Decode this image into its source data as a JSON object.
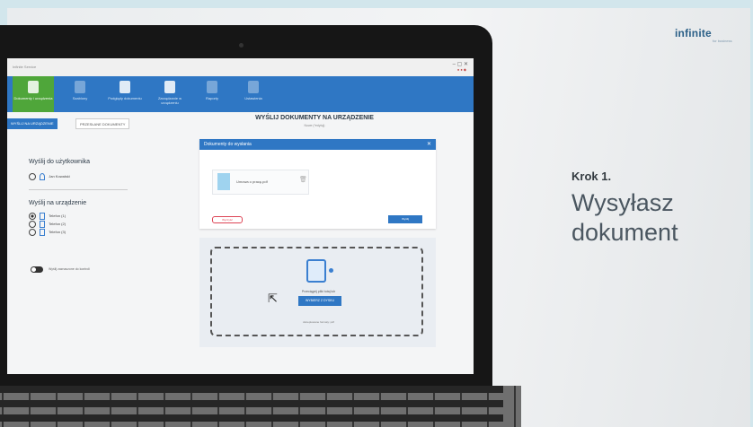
{
  "slide": {
    "brand": "infinite",
    "brand_sub": "for business",
    "step_label": "Krok 1.",
    "step_title": "Wysyłasz dokument"
  },
  "app": {
    "title_bar": "Infinite Service",
    "ribbon": [
      {
        "label": "Dokumenty i urządzenia",
        "icon": "phone-document-icon",
        "active": true
      },
      {
        "label": "Szablony",
        "icon": "template-icon",
        "active": false
      },
      {
        "label": "Podglądy dokumentu",
        "icon": "preview-icon",
        "active": false
      },
      {
        "label": "Zarządzanie w urządzeniu",
        "icon": "manage-icon",
        "active": false
      },
      {
        "label": "Raporty",
        "icon": "reports-icon",
        "active": false
      },
      {
        "label": "Ustawienia",
        "icon": "settings-icon",
        "active": false
      }
    ],
    "tabs": [
      "WYŚLIJ NA URZĄDZENIE",
      "PRZESŁANE DOKUMENTY"
    ],
    "heading": "WYŚLIJ DOKUMENTY NA URZĄDZENIE",
    "subheading": "Nowe (*edytuj)",
    "send_to_user": {
      "heading": "Wyślij do użytkownika",
      "user": "Jan Kowalski"
    },
    "send_to_device": {
      "heading": "Wyślij na urządzenie",
      "devices": [
        "Telefon (1)",
        "Telefon (2)",
        "Telefon (3)"
      ],
      "selected_index": 0
    },
    "toggle_label": "Wyślij zaznaczone do kontroli",
    "documents_card": {
      "title": "Dokumenty do wysłania",
      "file_name": "Umowa o pracę.pdf",
      "cancel_label": "Wyczyść",
      "send_label": "Wyślij"
    },
    "drop_zone": {
      "text": "Przeciągnij pliki tutaj lub",
      "button": "WYBIERZ Z DYSKU",
      "accepts": "Akceptowane formaty: pdf"
    }
  },
  "colors": {
    "accent": "#2f77c4",
    "active_green": "#4fa63a",
    "bezel": "#161616"
  }
}
